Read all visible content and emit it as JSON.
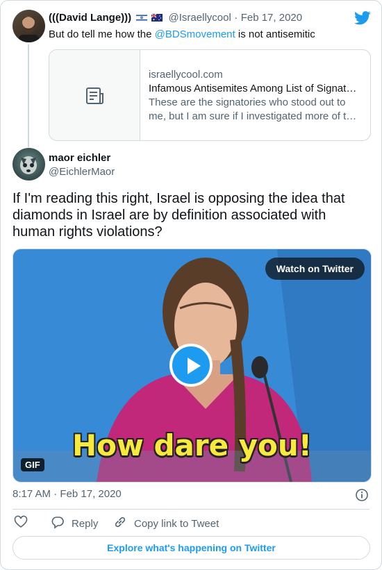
{
  "quoted_tweet": {
    "display_name": "(((David Lange)))",
    "handle": "@Israellycool",
    "separator": "·",
    "date": "Feb 17, 2020",
    "text_before": "But do tell me how the ",
    "mention": "@BDSmovement",
    "text_after": " is not antisemitic",
    "link_preview": {
      "domain": "israellycool.com",
      "title": "Infamous Antisemites Among List of Signat…",
      "description_line1": "These are the signatories who stood out to",
      "description_line2": "me, but I am sure if I investigated more of th…"
    }
  },
  "tweet": {
    "display_name": "maor eichler",
    "handle": "@EichlerMaor",
    "text_line1": "If I'm reading this right, Israel is opposing the idea that",
    "text_line2": "diamonds in Israel are by definition associated with",
    "text_line3": "human rights violations?",
    "media": {
      "watch_label": "Watch on Twitter",
      "gif_badge": "GIF",
      "caption": "How dare you!"
    },
    "timestamp": "8:17 AM · Feb 17, 2020"
  },
  "actions": {
    "reply_label": "Reply",
    "copy_label": "Copy link to Tweet"
  },
  "footer": {
    "explore_label": "Explore what's happening on Twitter"
  },
  "colors": {
    "accent": "#1d9bf0",
    "muted": "#536471",
    "border": "#cfd9de"
  },
  "icons": [
    "twitter-bird-icon",
    "israel-flag-icon",
    "australia-flag-icon",
    "document-icon",
    "play-icon",
    "info-icon",
    "heart-icon",
    "reply-icon",
    "link-icon"
  ]
}
